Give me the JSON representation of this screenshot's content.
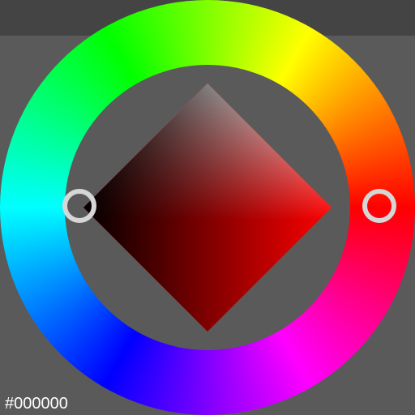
{
  "picker": {
    "hex_value": "#000000",
    "hue_color": "#ff0000",
    "background_color": "#5a5a5a",
    "marker_color": "#d6d6d6"
  }
}
